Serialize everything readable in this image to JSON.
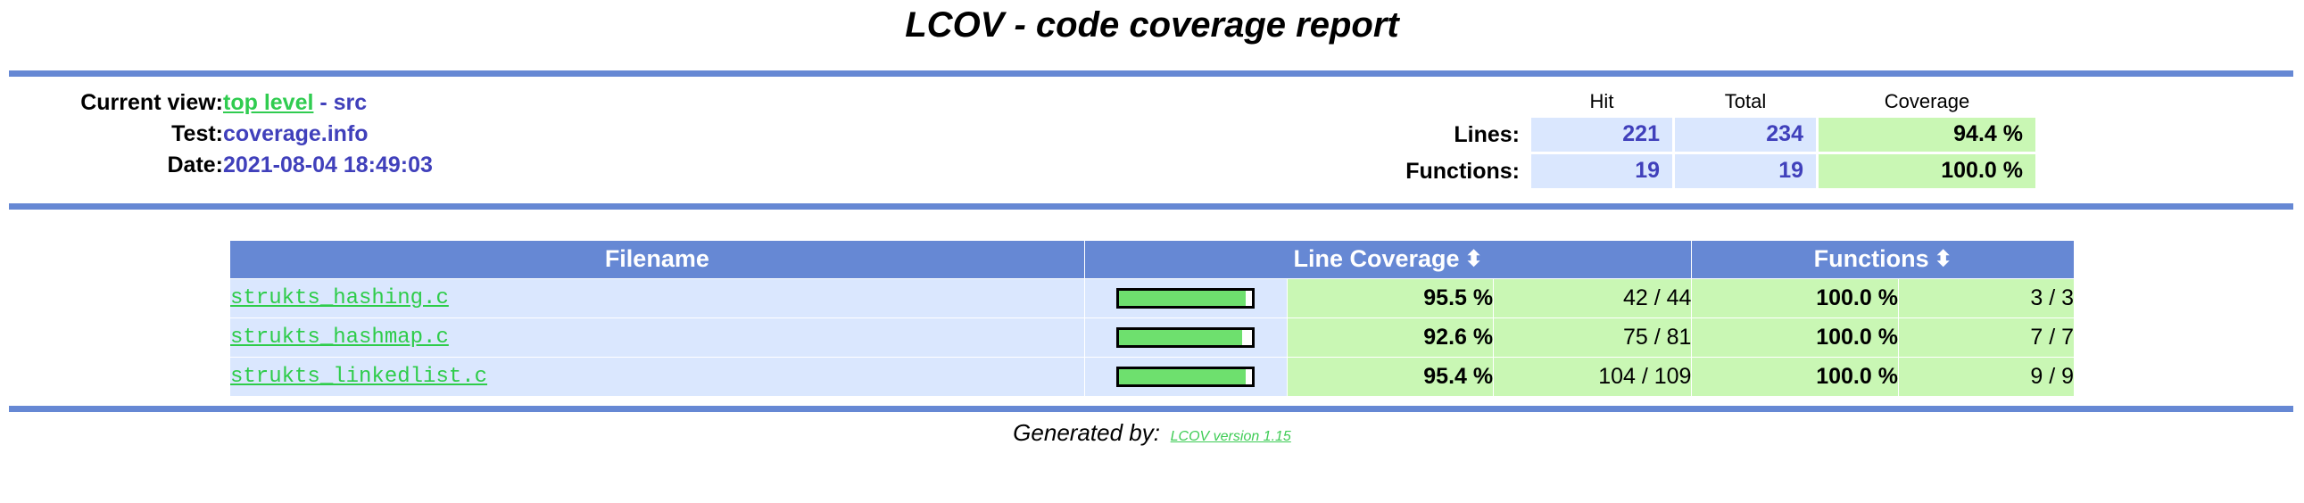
{
  "page": {
    "title": "LCOV - code coverage report"
  },
  "info": {
    "rows": [
      {
        "label": "Current view:",
        "link_text": "top level",
        "separator": " - ",
        "tail": "src"
      },
      {
        "label": "Test:",
        "value": "coverage.info"
      },
      {
        "label": "Date:",
        "value": "2021-08-04 18:49:03"
      }
    ]
  },
  "summary": {
    "columns": [
      "Hit",
      "Total",
      "Coverage"
    ],
    "rows": [
      {
        "label": "Lines:",
        "hit": "221",
        "total": "234",
        "coverage": "94.4 %"
      },
      {
        "label": "Functions:",
        "hit": "19",
        "total": "19",
        "coverage": "100.0 %"
      }
    ]
  },
  "coverage_table": {
    "headers": {
      "filename": "Filename",
      "line_coverage": "Line Coverage",
      "functions": "Functions",
      "sort_icon": "⬍"
    },
    "rows": [
      {
        "filename": "strukts_hashing.c",
        "line_pct": "95.5 %",
        "line_pct_value": 95.5,
        "line_ratio": "42 / 44",
        "func_pct": "100.0 %",
        "func_ratio": "3 / 3"
      },
      {
        "filename": "strukts_hashmap.c",
        "line_pct": "92.6 %",
        "line_pct_value": 92.6,
        "line_ratio": "75 / 81",
        "func_pct": "100.0 %",
        "func_ratio": "7 / 7"
      },
      {
        "filename": "strukts_linkedlist.c",
        "line_pct": "95.4 %",
        "line_pct_value": 95.4,
        "line_ratio": "104 / 109",
        "func_pct": "100.0 %",
        "func_ratio": "9 / 9"
      }
    ]
  },
  "footer": {
    "prefix": "Generated by:",
    "link_text": "LCOV version 1.15"
  },
  "colors": {
    "header_blue": "#6688d4",
    "row_blue": "#dae7fe",
    "cell_green": "#c9f7b4",
    "bar_green": "#6ee06e",
    "link_green": "#2ecc4a",
    "value_blue": "#4040bb"
  }
}
